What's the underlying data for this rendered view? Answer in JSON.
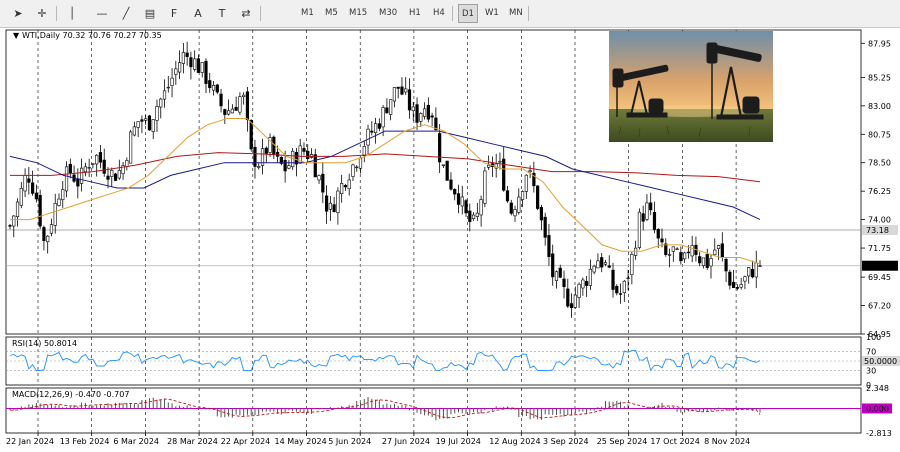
{
  "toolbar": {
    "tools": [
      {
        "name": "cursor-icon",
        "glyph": "➤"
      },
      {
        "name": "crosshair-icon",
        "glyph": "✛"
      },
      {
        "name": "vertical-line-icon",
        "glyph": "│"
      },
      {
        "name": "horizontal-line-icon",
        "glyph": "—"
      },
      {
        "name": "trendline-icon",
        "glyph": "╱"
      },
      {
        "name": "channel-icon",
        "glyph": "▤"
      },
      {
        "name": "fibonacci-icon",
        "glyph": "F"
      },
      {
        "name": "text-icon",
        "glyph": "A"
      },
      {
        "name": "label-icon",
        "glyph": "T"
      },
      {
        "name": "arrows-icon",
        "glyph": "⇄"
      }
    ],
    "timeframes": [
      "M1",
      "M5",
      "M15",
      "M30",
      "H1",
      "H4",
      "D1",
      "W1",
      "MN"
    ],
    "active_timeframe": "D1"
  },
  "chart": {
    "header": "WTI,Daily  70.32 70.76 70.27 70.35",
    "price_ticks": [
      "87.95",
      "85.25",
      "83.00",
      "80.75",
      "78.50",
      "76.25",
      "74.00",
      "71.75",
      "69.45",
      "67.20",
      "64.95"
    ],
    "hline_label": "73.18",
    "current_price_label": "70.35",
    "dates": [
      "22 Jan 2024",
      "13 Feb 2024",
      "6 Mar 2024",
      "28 Mar 2024",
      "22 Apr 2024",
      "14 May 2024",
      "5 Jun 2024",
      "27 Jun 2024",
      "19 Jul 2024",
      "12 Aug 2024",
      "3 Sep 2024",
      "25 Sep 2024",
      "17 Oct 2024",
      "8 Nov 2024"
    ]
  },
  "rsi": {
    "header": "RSI(14) 50.8014",
    "ticks": [
      "100",
      "70",
      "50",
      "30",
      "0"
    ],
    "current_label": "50.0000"
  },
  "macd": {
    "header": "MACD(12,26,9) -0.470 -0.707",
    "ticks": [
      "2.348",
      "0.000",
      "-2.813"
    ],
    "current_label": "0.000"
  },
  "colors": {
    "candle_up": "#000000",
    "candle_down": "#000000",
    "ma_fast": "#e0a030",
    "ma_mid": "#1a1a8c",
    "ma_slow": "#b01818",
    "rsi_line": "#1e90ff",
    "macd_signal": "#c81414",
    "zero_line": "#c000c0"
  },
  "chart_data": {
    "type": "candlestick",
    "symbol": "WTI",
    "timeframe": "Daily",
    "ohlc_last": {
      "open": 70.32,
      "high": 70.76,
      "low": 70.27,
      "close": 70.35
    },
    "ylim": [
      64.95,
      89.0
    ],
    "y_ticks": [
      87.95,
      85.25,
      83.0,
      80.75,
      78.5,
      76.25,
      74.0,
      71.75,
      69.45,
      67.2,
      64.95
    ],
    "x_labels": [
      "22 Jan 2024",
      "13 Feb 2024",
      "6 Mar 2024",
      "28 Mar 2024",
      "22 Apr 2024",
      "14 May 2024",
      "5 Jun 2024",
      "27 Jun 2024",
      "19 Jul 2024",
      "12 Aug 2024",
      "3 Sep 2024",
      "25 Sep 2024",
      "17 Oct 2024",
      "8 Nov 2024"
    ],
    "close_path": [
      73.5,
      75.5,
      77.8,
      76.0,
      72.0,
      74.5,
      77.0,
      77.8,
      76.9,
      78.5,
      79.0,
      78.2,
      77.5,
      78.0,
      80.5,
      82.0,
      81.5,
      83.0,
      84.0,
      85.5,
      87.0,
      86.8,
      86.0,
      85.0,
      83.5,
      82.5,
      83.0,
      84.0,
      79.0,
      78.5,
      80.0,
      78.5,
      78.0,
      79.0,
      79.5,
      79.0,
      77.0,
      74.5,
      76.0,
      77.5,
      78.5,
      80.0,
      81.0,
      82.0,
      83.5,
      84.5,
      83.5,
      82.0,
      83.0,
      82.5,
      78.5,
      77.0,
      76.0,
      74.0,
      73.5,
      77.0,
      78.5,
      78.0,
      74.5,
      76.0,
      78.0,
      76.0,
      72.5,
      69.5,
      68.5,
      67.5,
      68.5,
      69.5,
      71.0,
      70.5,
      68.5,
      68.0,
      70.5,
      74.0,
      75.0,
      72.5,
      71.0,
      71.5,
      70.0,
      72.5,
      71.0,
      70.5,
      72.0,
      70.0,
      68.5,
      69.0,
      70.0,
      70.35
    ],
    "series": [
      {
        "name": "MA fast",
        "values": [
          74.0,
          74.0,
          74.5,
          75.0,
          75.5,
          76.0,
          76.5,
          77.5,
          79.0,
          80.5,
          81.5,
          82.0,
          82.0,
          80.5,
          79.0,
          78.5,
          78.5,
          78.5,
          79.0,
          80.0,
          81.0,
          81.5,
          81.0,
          80.0,
          78.5,
          78.0,
          78.0,
          77.0,
          75.0,
          73.5,
          72.0,
          71.5,
          71.5,
          72.0,
          72.0,
          71.5,
          71.0,
          71.0,
          70.5
        ]
      },
      {
        "name": "MA mid",
        "values": [
          79.0,
          78.5,
          77.5,
          77.0,
          76.5,
          76.5,
          77.5,
          78.0,
          78.5,
          78.5,
          78.5,
          78.5,
          79.0,
          80.0,
          81.0,
          81.0,
          81.0,
          80.5,
          80.0,
          79.5,
          79.0,
          78.0,
          77.5,
          77.0,
          76.5,
          76.0,
          75.5,
          75.0,
          74.0
        ]
      },
      {
        "name": "MA slow",
        "values": [
          77.5,
          77.5,
          77.8,
          78.3,
          79.0,
          79.3,
          79.2,
          79.0,
          79.0,
          79.2,
          79.0,
          78.8,
          78.3,
          77.8,
          77.8,
          77.7,
          77.5,
          77.4,
          77.0
        ]
      }
    ],
    "horizontal_line": 73.18,
    "indicators": {
      "rsi": {
        "period": 14,
        "value": 50.8014,
        "levels": [
          70,
          50,
          30
        ],
        "ylim": [
          0,
          100
        ]
      },
      "macd": {
        "params": [
          12,
          26,
          9
        ],
        "macd": -0.47,
        "signal": -0.707,
        "ylim": [
          -2.813,
          2.348
        ]
      }
    }
  }
}
